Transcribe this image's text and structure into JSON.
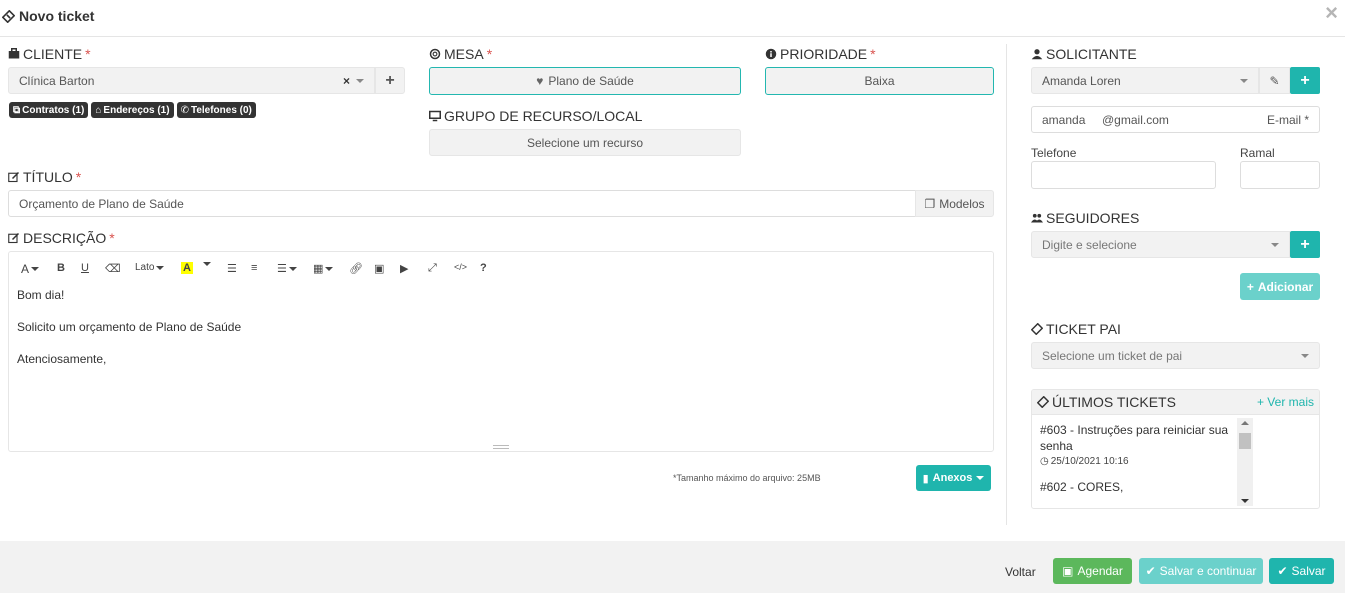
{
  "header": {
    "title": "Novo ticket",
    "close_icon": "×"
  },
  "cliente": {
    "label": "CLIENTE",
    "required": "*",
    "value": "Clínica Barton",
    "clear": "×",
    "add": "+",
    "tags": [
      {
        "label": "Contratos (1)",
        "icon": "copy-icon"
      },
      {
        "label": "Endereços (1)",
        "icon": "home-icon"
      },
      {
        "label": "Telefones (0)",
        "icon": "phone-icon"
      }
    ]
  },
  "mesa": {
    "label": "MESA",
    "required": "*",
    "value": "Plano de Saúde"
  },
  "prioridade": {
    "label": "PRIORIDADE",
    "required": "*",
    "value": "Baixa"
  },
  "grupo": {
    "label": "GRUPO DE RECURSO/LOCAL",
    "value": "Selecione um recurso"
  },
  "titulo": {
    "label": "TÍTULO",
    "required": "*",
    "value": "Orçamento de Plano de Saúde",
    "modelos": "Modelos"
  },
  "descricao": {
    "label": "DESCRIÇÃO",
    "required": "*",
    "toolbar": {
      "font_a": "A",
      "bold": "B",
      "underline": "U",
      "font_name": "Lato",
      "highlight": "A",
      "help": "?"
    },
    "lines": [
      "Bom dia!",
      "Solicito um orçamento de Plano de Saúde",
      "Atenciosamente,"
    ]
  },
  "anexos": {
    "note": "*Tamanho máximo do arquivo: 25MB",
    "button": "Anexos"
  },
  "solicitante": {
    "label": "SOLICITANTE",
    "value": "Amanda Loren",
    "email_user": "amanda",
    "email_domain": "@gmail.com",
    "email_label": "E-mail *",
    "telefone_label": "Telefone",
    "ramal_label": "Ramal",
    "add": "+"
  },
  "seguidores": {
    "label": "SEGUIDORES",
    "placeholder": "Digite e selecione",
    "add": "+",
    "adicionar": "Adicionar"
  },
  "ticket_pai": {
    "label": "TICKET PAI",
    "placeholder": "Selecione um ticket de pai"
  },
  "ultimos": {
    "label": "ÚLTIMOS TICKETS",
    "ver_mais": "+ Ver mais",
    "items": [
      {
        "title_l1": "#603 - Instruções para reiniciar sua",
        "title_l2": "senha",
        "date": "25/10/2021 10:16"
      },
      {
        "title_l1": "#602 - CORES,",
        "title_l2": "",
        "date": ""
      }
    ]
  },
  "footer": {
    "voltar": "Voltar",
    "agendar": "Agendar",
    "salvar_continuar": "Salvar e continuar",
    "salvar": "Salvar"
  },
  "colors": {
    "accent": "#1fb5ad",
    "green": "#5cb85c",
    "required": "#d9534f"
  }
}
